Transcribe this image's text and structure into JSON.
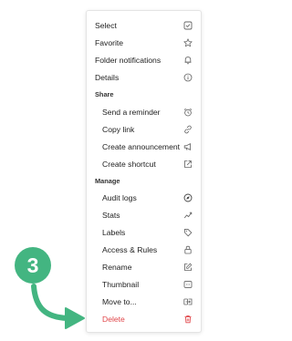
{
  "menu": {
    "top_items": [
      {
        "label": "Select",
        "icon": "checkbox-icon"
      },
      {
        "label": "Favorite",
        "icon": "star-icon"
      },
      {
        "label": "Folder notifications",
        "icon": "bell-icon"
      },
      {
        "label": "Details",
        "icon": "info-icon"
      }
    ],
    "share": {
      "title": "Share",
      "items": [
        {
          "label": "Send a reminder",
          "icon": "alarm-clock-icon"
        },
        {
          "label": "Copy link",
          "icon": "link-icon"
        },
        {
          "label": "Create announcement",
          "icon": "megaphone-icon"
        },
        {
          "label": "Create shortcut",
          "icon": "shortcut-icon"
        }
      ]
    },
    "manage": {
      "title": "Manage",
      "items": [
        {
          "label": "Audit logs",
          "icon": "compass-icon"
        },
        {
          "label": "Stats",
          "icon": "chart-icon"
        },
        {
          "label": "Labels",
          "icon": "tag-icon"
        },
        {
          "label": "Access & Rules",
          "icon": "lock-icon"
        },
        {
          "label": "Rename",
          "icon": "edit-icon"
        },
        {
          "label": "Thumbnail",
          "icon": "image-icon"
        },
        {
          "label": "Move to...",
          "icon": "move-icon"
        },
        {
          "label": "Delete",
          "icon": "trash-icon"
        }
      ]
    }
  },
  "annotation": {
    "step_number": "3",
    "accent_color": "#43b581"
  },
  "colors": {
    "delete": "#e0464a",
    "text": "#222222",
    "icon": "#666666"
  }
}
